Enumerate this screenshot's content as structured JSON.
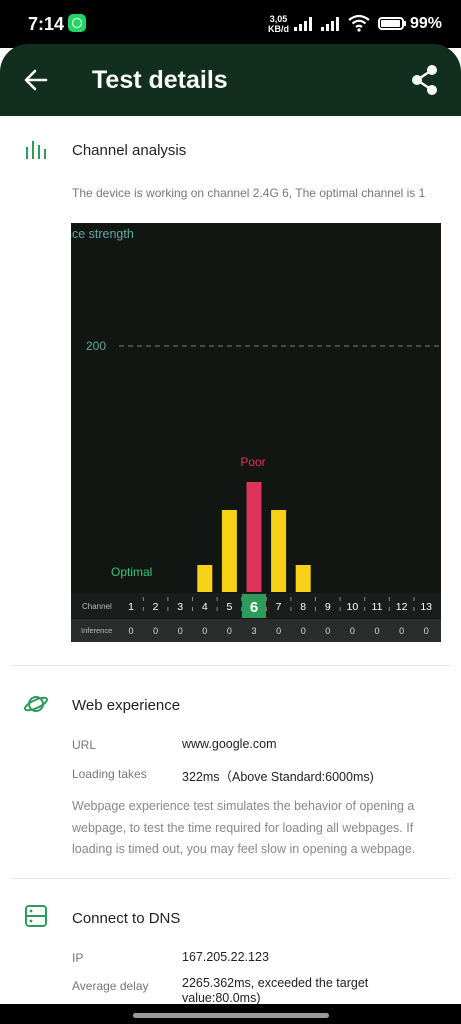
{
  "status_bar": {
    "time": "7:14",
    "speed_value": "3,05",
    "speed_unit": "KB/d",
    "battery": "99%"
  },
  "header": {
    "title": "Test details"
  },
  "channel_analysis": {
    "title": "Channel analysis",
    "description": "The device is working on channel 2.4G 6, The optimal channel is 1"
  },
  "web_experience": {
    "title": "Web experience",
    "url_label": "URL",
    "url_value": "www.google.com",
    "loading_label": "Loading takes",
    "loading_value": "322ms（Above Standard:6000ms)",
    "description": "Webpage experience test simulates the behavior of opening a webpage, to test the time required for loading all webpages. If loading is timed out, you may feel slow in opening a webpage."
  },
  "dns": {
    "title": "Connect to DNS",
    "ip_label": "IP",
    "ip_value": "167.205.22.123",
    "delay_label": "Average delay",
    "delay_value": "2265.362ms, exceeded the target value:80.0ms)"
  },
  "colors": {
    "header_bg": "#112e1e",
    "accent": "#2e9a5c",
    "poor": "#e0335a",
    "bar": "#f7d117",
    "chart_bg": "#111612"
  },
  "chart_data": {
    "type": "bar",
    "ylabel": "nce strength",
    "ref_label": "200",
    "ref_value": 200,
    "categories": [
      "1",
      "2",
      "3",
      "4",
      "5",
      "6",
      "7",
      "8",
      "9",
      "10",
      "11",
      "12",
      "13"
    ],
    "values": [
      0,
      0,
      0,
      0,
      0,
      3,
      0,
      0,
      0,
      0,
      0,
      0,
      0
    ],
    "bar_heights": [
      0,
      0,
      0,
      27,
      82,
      110,
      82,
      27,
      0,
      0,
      0,
      0,
      0
    ],
    "row_labels": [
      "Channel",
      "Inference"
    ],
    "current_channel": "6",
    "optimal_channel": "1",
    "annotations": {
      "poor": "Poor",
      "optimal": "Optimal"
    }
  }
}
